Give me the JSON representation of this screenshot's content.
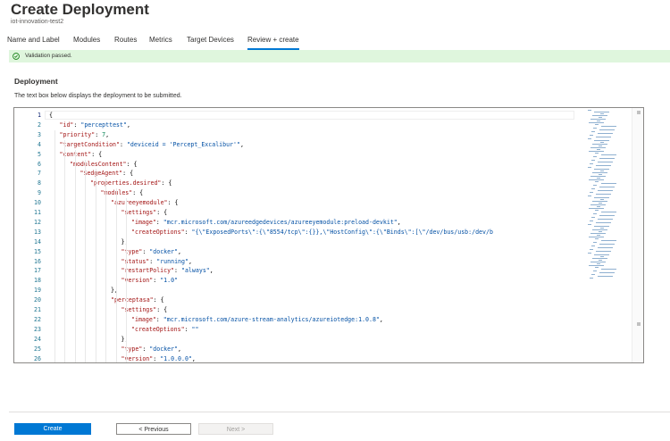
{
  "header": {
    "title": "Create Deployment",
    "more": "···",
    "subtitle": "iot-innovation-test2"
  },
  "tabs": [
    {
      "label": "Name and Label"
    },
    {
      "label": "Modules"
    },
    {
      "label": "Routes"
    },
    {
      "label": "Metrics"
    },
    {
      "label": "Target Devices"
    },
    {
      "label": "Review + create",
      "active": true
    }
  ],
  "banner": {
    "message": "Validation passed.",
    "color": "#dff6dd"
  },
  "section": {
    "title": "Deployment",
    "description": "The text box below displays the deployment to be submitted."
  },
  "editor": {
    "line_numbers": [
      "1",
      "2",
      "3",
      "4",
      "5",
      "6",
      "7",
      "8",
      "9",
      "10",
      "11",
      "12",
      "13",
      "14",
      "15",
      "16",
      "17",
      "18",
      "19",
      "20",
      "21",
      "22",
      "23",
      "24",
      "25",
      "26"
    ],
    "lines": [
      [
        [
          "p",
          "{"
        ]
      ],
      [
        [
          "k",
          "\"id\""
        ],
        [
          "p",
          ": "
        ],
        [
          "s",
          "\"percepttest\""
        ],
        [
          "p",
          ","
        ]
      ],
      [
        [
          "k",
          "\"priority\""
        ],
        [
          "p",
          ": "
        ],
        [
          "n",
          "7"
        ],
        [
          "p",
          ","
        ]
      ],
      [
        [
          "k",
          "\"targetCondition\""
        ],
        [
          "p",
          ": "
        ],
        [
          "s",
          "\"deviceid = 'Percept_Excalibur'\""
        ],
        [
          "p",
          ","
        ]
      ],
      [
        [
          "k",
          "\"content\""
        ],
        [
          "p",
          ": {"
        ]
      ],
      [
        [
          "k",
          "\"modulesContent\""
        ],
        [
          "p",
          ": {"
        ]
      ],
      [
        [
          "k",
          "\"$edgeAgent\""
        ],
        [
          "p",
          ": {"
        ]
      ],
      [
        [
          "k",
          "\"properties.desired\""
        ],
        [
          "p",
          ": {"
        ]
      ],
      [
        [
          "k",
          "\"modules\""
        ],
        [
          "p",
          ": {"
        ]
      ],
      [
        [
          "k",
          "\"azureeyemodule\""
        ],
        [
          "p",
          ": {"
        ]
      ],
      [
        [
          "k",
          "\"settings\""
        ],
        [
          "p",
          ": {"
        ]
      ],
      [
        [
          "k",
          "\"image\""
        ],
        [
          "p",
          ": "
        ],
        [
          "s",
          "\"mcr.microsoft.com/azureedgedevices/azureeyemodule:preload-devkit\""
        ],
        [
          "p",
          ","
        ]
      ],
      [
        [
          "k",
          "\"createOptions\""
        ],
        [
          "p",
          ": "
        ],
        [
          "s",
          "\"{\\\"ExposedPorts\\\":{\\\"8554/tcp\\\":{}},\\\"HostConfig\\\":{\\\"Binds\\\":[\\\"/dev/bus/usb:/dev/b"
        ]
      ],
      [
        [
          "p",
          "},"
        ]
      ],
      [
        [
          "k",
          "\"type\""
        ],
        [
          "p",
          ": "
        ],
        [
          "s",
          "\"docker\""
        ],
        [
          "p",
          ","
        ]
      ],
      [
        [
          "k",
          "\"status\""
        ],
        [
          "p",
          ": "
        ],
        [
          "s",
          "\"running\""
        ],
        [
          "p",
          ","
        ]
      ],
      [
        [
          "k",
          "\"restartPolicy\""
        ],
        [
          "p",
          ": "
        ],
        [
          "s",
          "\"always\""
        ],
        [
          "p",
          ","
        ]
      ],
      [
        [
          "k",
          "\"version\""
        ],
        [
          "p",
          ": "
        ],
        [
          "s",
          "\"1.0\""
        ]
      ],
      [
        [
          "p",
          "},"
        ]
      ],
      [
        [
          "k",
          "\"perceptasa\""
        ],
        [
          "p",
          ": {"
        ]
      ],
      [
        [
          "k",
          "\"settings\""
        ],
        [
          "p",
          ": {"
        ]
      ],
      [
        [
          "k",
          "\"image\""
        ],
        [
          "p",
          ": "
        ],
        [
          "s",
          "\"mcr.microsoft.com/azure-stream-analytics/azureiotedge:1.0.8\""
        ],
        [
          "p",
          ","
        ]
      ],
      [
        [
          "k",
          "\"createOptions\""
        ],
        [
          "p",
          ": "
        ],
        [
          "s",
          "\"\""
        ]
      ],
      [
        [
          "p",
          "},"
        ]
      ],
      [
        [
          "k",
          "\"type\""
        ],
        [
          "p",
          ": "
        ],
        [
          "s",
          "\"docker\""
        ],
        [
          "p",
          ","
        ]
      ],
      [
        [
          "k",
          "\"version\""
        ],
        [
          "p",
          ": "
        ],
        [
          "s",
          "\"1.0.0.0\""
        ],
        [
          "p",
          ","
        ]
      ]
    ],
    "indent_levels": [
      0,
      1,
      1,
      1,
      1,
      2,
      3,
      4,
      5,
      6,
      7,
      8,
      8,
      7,
      7,
      7,
      7,
      7,
      6,
      6,
      7,
      8,
      8,
      7,
      7,
      7
    ]
  },
  "footer": {
    "create_label": "Create",
    "previous_label": "< Previous",
    "next_label": "Next >"
  }
}
